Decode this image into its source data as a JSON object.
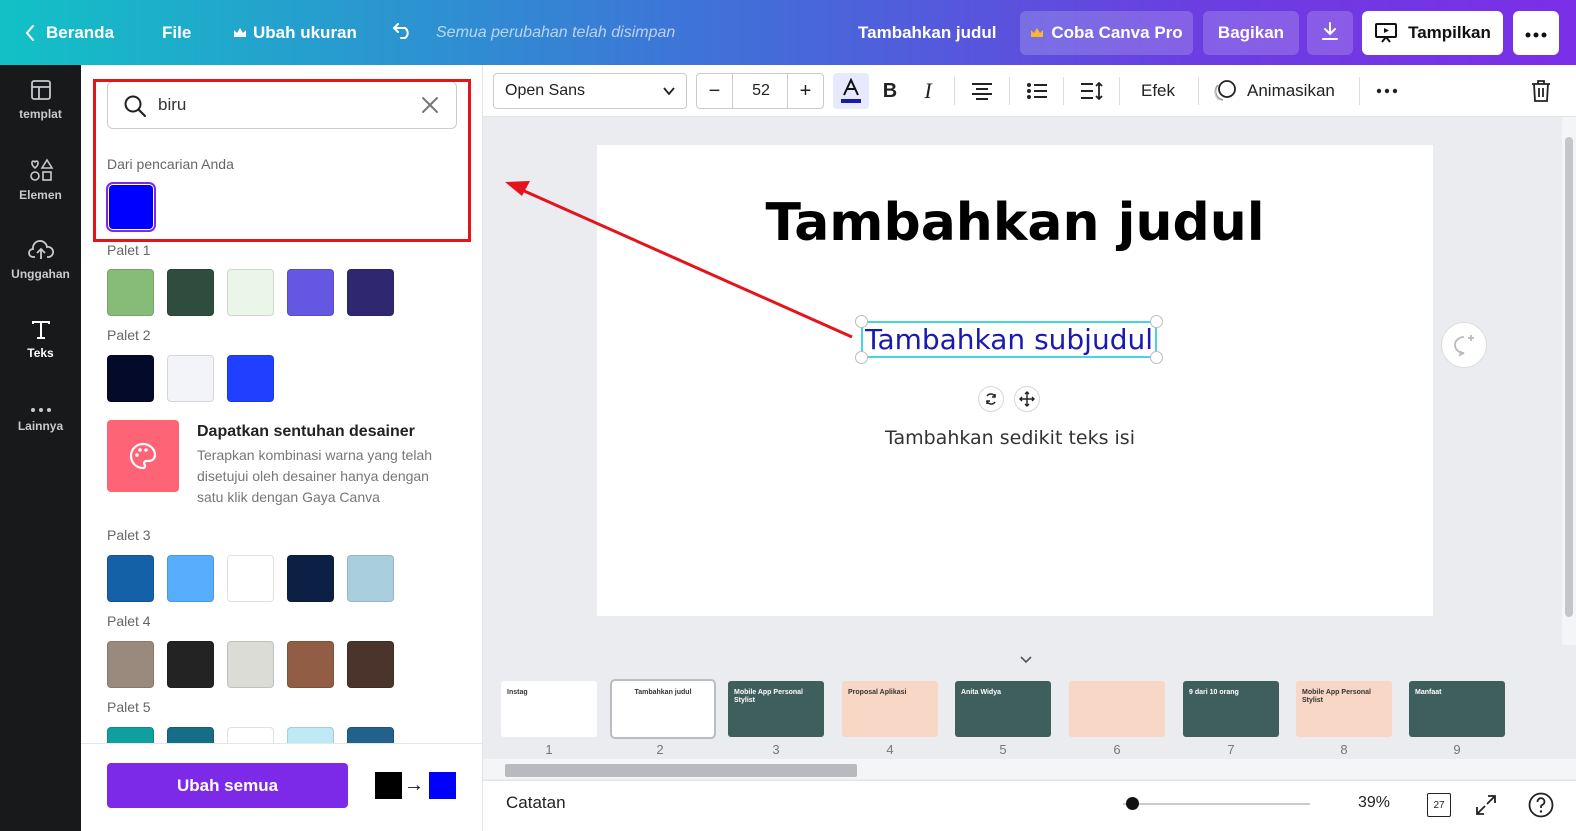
{
  "topbar": {
    "home_label": "Beranda",
    "file_label": "File",
    "resize_label": "Ubah ukuran",
    "saved_status": "Semua perubahan telah disimpan",
    "doc_title": "Tambahkan judul",
    "try_pro_label": "Coba Canva Pro",
    "share_label": "Bagikan",
    "present_label": "Tampilkan"
  },
  "rail": {
    "items": [
      {
        "label": "templat",
        "icon": "template-icon"
      },
      {
        "label": "Elemen",
        "icon": "elements-icon"
      },
      {
        "label": "Unggahan",
        "icon": "upload-cloud-icon"
      },
      {
        "label": "Teks",
        "icon": "text-icon"
      },
      {
        "label": "Lainnya",
        "icon": "more-dots-icon"
      }
    ]
  },
  "panel": {
    "search_value": "biru",
    "from_search_label": "Dari pencarian Anda",
    "search_result_color": "#0000ff",
    "palettes": [
      {
        "label": "Palet 1",
        "colors": [
          "#86bc78",
          "#2e4d3f",
          "#eaf6e7",
          "#6458e2",
          "#2f2870"
        ]
      },
      {
        "label": "Palet 2",
        "colors": [
          "#040b2a",
          "#f3f4fa",
          "#2040ff"
        ]
      },
      {
        "label": "Palet 3",
        "colors": [
          "#1561a8",
          "#57aefc",
          "#ffffff",
          "#0c1f45",
          "#a9cfdf"
        ]
      },
      {
        "label": "Palet 4",
        "colors": [
          "#9a8a7d",
          "#232323",
          "#dcdcd7",
          "#915e45",
          "#4a342c"
        ]
      },
      {
        "label": "Palet 5",
        "colors": [
          "#0f9f9e",
          "#176d86",
          "#ffffff",
          "#bfeaf5",
          "#22608e"
        ]
      }
    ],
    "promo": {
      "title": "Dapatkan sentuhan desainer",
      "text": "Terapkan kombinasi warna yang telah disetujui oleh desainer hanya dengan satu klik dengan Gaya Canva"
    },
    "change_all_label": "Ubah semua",
    "swap_from_color": "#000000",
    "swap_to_color": "#0000ff",
    "swap_arrow": "→"
  },
  "toolbar": {
    "font_name": "Open Sans",
    "font_size": "52",
    "minus": "−",
    "plus": "+",
    "bold": "B",
    "italic": "I",
    "effects_label": "Efek",
    "animate_label": "Animasikan",
    "text_color": "#1a1ab0"
  },
  "canvas": {
    "title": "Tambahkan judul",
    "subtitle": "Tambahkan subjudul",
    "body": "Tambahkan sedikit teks isi"
  },
  "thumbnails": [
    {
      "num": "1",
      "bg": "#ffffff",
      "caption": "Instag"
    },
    {
      "num": "2",
      "bg": "#ffffff",
      "caption": "Tambahkan judul"
    },
    {
      "num": "3",
      "bg": "#3f5f5c",
      "caption": "Mobile App Personal Stylist"
    },
    {
      "num": "4",
      "bg": "#f9d7c6",
      "caption": "Proposal Aplikasi"
    },
    {
      "num": "5",
      "bg": "#3f5f5c",
      "caption": "Anita Widya"
    },
    {
      "num": "6",
      "bg": "#f9d7c6",
      "caption": ""
    },
    {
      "num": "7",
      "bg": "#3f5f5c",
      "caption": "9 dari 10 orang"
    },
    {
      "num": "8",
      "bg": "#f9d7c6",
      "caption": "Mobile App Personal Stylist"
    },
    {
      "num": "9",
      "bg": "#3f5f5c",
      "caption": "Manfaat"
    }
  ],
  "bottombar": {
    "notes_label": "Catatan",
    "zoom": "39%",
    "page_count": "27"
  },
  "colors": {
    "accent": "#7d2ae8",
    "highlight_box": "#e3141b",
    "selection": "#4bd4e0"
  }
}
